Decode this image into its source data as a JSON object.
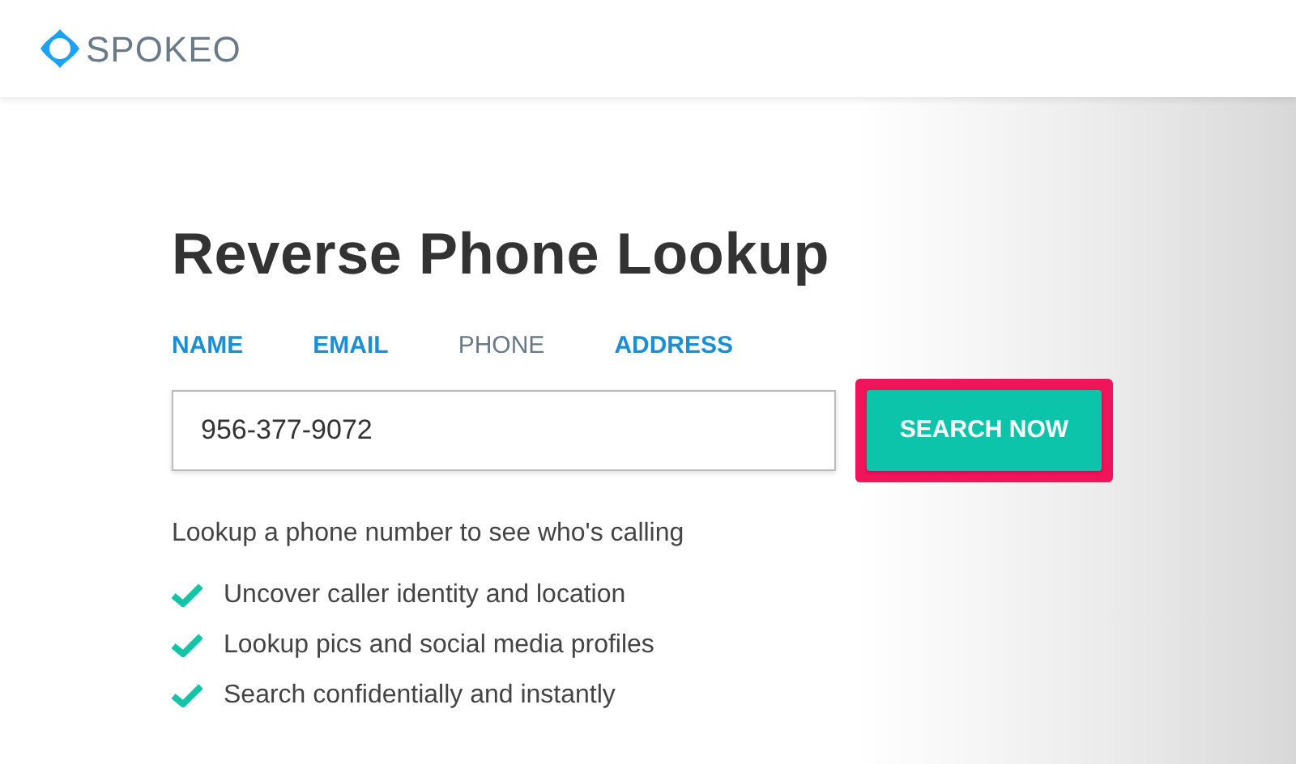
{
  "header": {
    "logo_text": "SPOKEO"
  },
  "title": "Reverse Phone Lookup",
  "tabs": [
    {
      "label": "NAME",
      "selected": false
    },
    {
      "label": "EMAIL",
      "selected": false
    },
    {
      "label": "PHONE",
      "selected": true
    },
    {
      "label": "ADDRESS",
      "selected": false
    }
  ],
  "search": {
    "value": "956-377-9072",
    "button": "SEARCH NOW",
    "button_highlighted": true
  },
  "description": "Lookup a phone number to see who's calling",
  "features": [
    "Uncover caller identity and location",
    "Lookup pics and social media profiles",
    "Search confidentially and instantly"
  ]
}
